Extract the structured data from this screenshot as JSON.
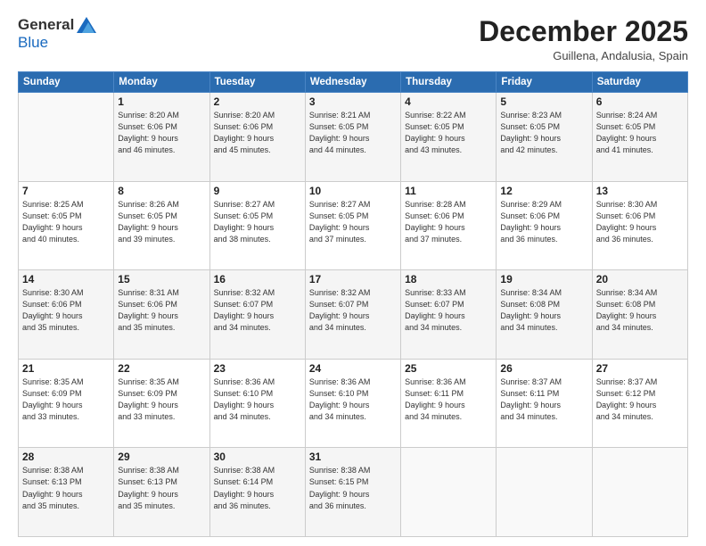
{
  "header": {
    "logo_general": "General",
    "logo_blue": "Blue",
    "month_title": "December 2025",
    "subtitle": "Guillena, Andalusia, Spain"
  },
  "days_of_week": [
    "Sunday",
    "Monday",
    "Tuesday",
    "Wednesday",
    "Thursday",
    "Friday",
    "Saturday"
  ],
  "weeks": [
    [
      {
        "day": "",
        "info": ""
      },
      {
        "day": "1",
        "info": "Sunrise: 8:20 AM\nSunset: 6:06 PM\nDaylight: 9 hours\nand 46 minutes."
      },
      {
        "day": "2",
        "info": "Sunrise: 8:20 AM\nSunset: 6:06 PM\nDaylight: 9 hours\nand 45 minutes."
      },
      {
        "day": "3",
        "info": "Sunrise: 8:21 AM\nSunset: 6:05 PM\nDaylight: 9 hours\nand 44 minutes."
      },
      {
        "day": "4",
        "info": "Sunrise: 8:22 AM\nSunset: 6:05 PM\nDaylight: 9 hours\nand 43 minutes."
      },
      {
        "day": "5",
        "info": "Sunrise: 8:23 AM\nSunset: 6:05 PM\nDaylight: 9 hours\nand 42 minutes."
      },
      {
        "day": "6",
        "info": "Sunrise: 8:24 AM\nSunset: 6:05 PM\nDaylight: 9 hours\nand 41 minutes."
      }
    ],
    [
      {
        "day": "7",
        "info": "Sunrise: 8:25 AM\nSunset: 6:05 PM\nDaylight: 9 hours\nand 40 minutes."
      },
      {
        "day": "8",
        "info": "Sunrise: 8:26 AM\nSunset: 6:05 PM\nDaylight: 9 hours\nand 39 minutes."
      },
      {
        "day": "9",
        "info": "Sunrise: 8:27 AM\nSunset: 6:05 PM\nDaylight: 9 hours\nand 38 minutes."
      },
      {
        "day": "10",
        "info": "Sunrise: 8:27 AM\nSunset: 6:05 PM\nDaylight: 9 hours\nand 37 minutes."
      },
      {
        "day": "11",
        "info": "Sunrise: 8:28 AM\nSunset: 6:06 PM\nDaylight: 9 hours\nand 37 minutes."
      },
      {
        "day": "12",
        "info": "Sunrise: 8:29 AM\nSunset: 6:06 PM\nDaylight: 9 hours\nand 36 minutes."
      },
      {
        "day": "13",
        "info": "Sunrise: 8:30 AM\nSunset: 6:06 PM\nDaylight: 9 hours\nand 36 minutes."
      }
    ],
    [
      {
        "day": "14",
        "info": "Sunrise: 8:30 AM\nSunset: 6:06 PM\nDaylight: 9 hours\nand 35 minutes."
      },
      {
        "day": "15",
        "info": "Sunrise: 8:31 AM\nSunset: 6:06 PM\nDaylight: 9 hours\nand 35 minutes."
      },
      {
        "day": "16",
        "info": "Sunrise: 8:32 AM\nSunset: 6:07 PM\nDaylight: 9 hours\nand 34 minutes."
      },
      {
        "day": "17",
        "info": "Sunrise: 8:32 AM\nSunset: 6:07 PM\nDaylight: 9 hours\nand 34 minutes."
      },
      {
        "day": "18",
        "info": "Sunrise: 8:33 AM\nSunset: 6:07 PM\nDaylight: 9 hours\nand 34 minutes."
      },
      {
        "day": "19",
        "info": "Sunrise: 8:34 AM\nSunset: 6:08 PM\nDaylight: 9 hours\nand 34 minutes."
      },
      {
        "day": "20",
        "info": "Sunrise: 8:34 AM\nSunset: 6:08 PM\nDaylight: 9 hours\nand 34 minutes."
      }
    ],
    [
      {
        "day": "21",
        "info": "Sunrise: 8:35 AM\nSunset: 6:09 PM\nDaylight: 9 hours\nand 33 minutes."
      },
      {
        "day": "22",
        "info": "Sunrise: 8:35 AM\nSunset: 6:09 PM\nDaylight: 9 hours\nand 33 minutes."
      },
      {
        "day": "23",
        "info": "Sunrise: 8:36 AM\nSunset: 6:10 PM\nDaylight: 9 hours\nand 34 minutes."
      },
      {
        "day": "24",
        "info": "Sunrise: 8:36 AM\nSunset: 6:10 PM\nDaylight: 9 hours\nand 34 minutes."
      },
      {
        "day": "25",
        "info": "Sunrise: 8:36 AM\nSunset: 6:11 PM\nDaylight: 9 hours\nand 34 minutes."
      },
      {
        "day": "26",
        "info": "Sunrise: 8:37 AM\nSunset: 6:11 PM\nDaylight: 9 hours\nand 34 minutes."
      },
      {
        "day": "27",
        "info": "Sunrise: 8:37 AM\nSunset: 6:12 PM\nDaylight: 9 hours\nand 34 minutes."
      }
    ],
    [
      {
        "day": "28",
        "info": "Sunrise: 8:38 AM\nSunset: 6:13 PM\nDaylight: 9 hours\nand 35 minutes."
      },
      {
        "day": "29",
        "info": "Sunrise: 8:38 AM\nSunset: 6:13 PM\nDaylight: 9 hours\nand 35 minutes."
      },
      {
        "day": "30",
        "info": "Sunrise: 8:38 AM\nSunset: 6:14 PM\nDaylight: 9 hours\nand 36 minutes."
      },
      {
        "day": "31",
        "info": "Sunrise: 8:38 AM\nSunset: 6:15 PM\nDaylight: 9 hours\nand 36 minutes."
      },
      {
        "day": "",
        "info": ""
      },
      {
        "day": "",
        "info": ""
      },
      {
        "day": "",
        "info": ""
      }
    ]
  ]
}
